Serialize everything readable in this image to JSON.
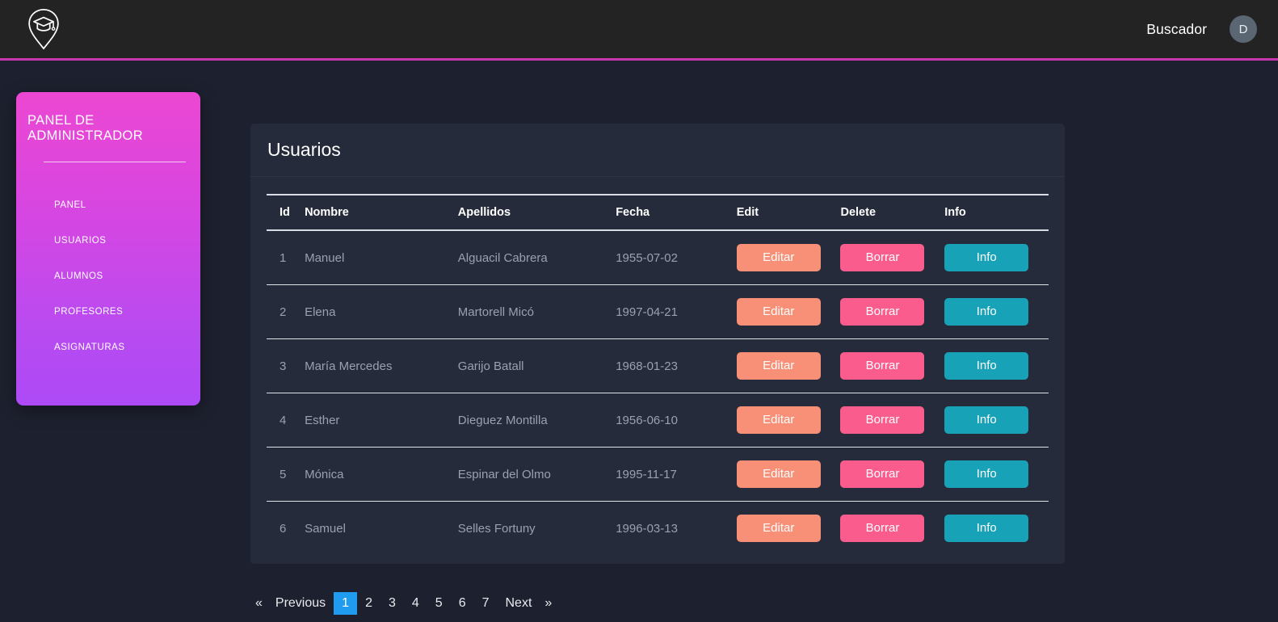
{
  "navbar": {
    "logo_icon": "graduation-cap-pin-logo",
    "search_label": "Buscador",
    "avatar_initial": "D",
    "bottom_accent_color": "#c837ab",
    "background_color": "#232323"
  },
  "sidebar": {
    "title": "PANEL DE ADMINISTRADOR",
    "gradient_from": "#ec47d2",
    "gradient_to": "#ad4af6",
    "items": [
      {
        "label": "PANEL"
      },
      {
        "label": "USUARIOS"
      },
      {
        "label": "ALUMNOS"
      },
      {
        "label": "PROFESORES"
      },
      {
        "label": "ASIGNATURAS"
      }
    ]
  },
  "card": {
    "title": "Usuarios",
    "background_color": "#262b3c"
  },
  "table": {
    "columns": [
      "Id",
      "Nombre",
      "Apellidos",
      "Fecha",
      "Edit",
      "Delete",
      "Info"
    ],
    "action_labels": {
      "edit": "Editar",
      "delete": "Borrar",
      "info": "Info"
    },
    "action_colors": {
      "edit": "#f89078",
      "delete": "#fb5c8e",
      "info": "#17a2b8"
    },
    "rows": [
      {
        "id": "1",
        "nombre": "Manuel",
        "apellidos": "Alguacil Cabrera",
        "fecha": "1955-07-02"
      },
      {
        "id": "2",
        "nombre": "Elena",
        "apellidos": "Martorell Micó",
        "fecha": "1997-04-21"
      },
      {
        "id": "3",
        "nombre": "María Mercedes",
        "apellidos": "Garijo Batall",
        "fecha": "1968-01-23"
      },
      {
        "id": "4",
        "nombre": "Esther",
        "apellidos": "Dieguez Montilla",
        "fecha": "1956-06-10"
      },
      {
        "id": "5",
        "nombre": "Mónica",
        "apellidos": "Espinar del Olmo",
        "fecha": "1995-11-17"
      },
      {
        "id": "6",
        "nombre": "Samuel",
        "apellidos": "Selles Fortuny",
        "fecha": "1996-03-13"
      }
    ]
  },
  "pagination": {
    "first_chevron": "«",
    "previous_label": "Previous",
    "pages": [
      "1",
      "2",
      "3",
      "4",
      "5",
      "6",
      "7"
    ],
    "active_page": "1",
    "next_label": "Next",
    "last_chevron": "»",
    "active_color": "#1f9bf0"
  }
}
